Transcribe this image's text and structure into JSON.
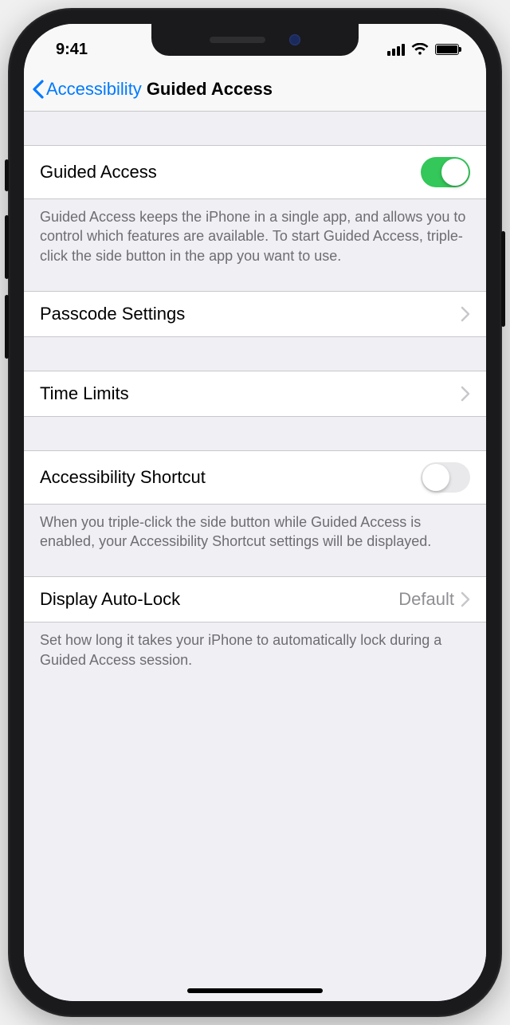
{
  "status": {
    "time": "9:41"
  },
  "nav": {
    "back_label": "Accessibility",
    "title": "Guided Access"
  },
  "rows": {
    "guided_access": {
      "label": "Guided Access",
      "enabled": true,
      "footer": "Guided Access keeps the iPhone in a single app, and allows you to control which features are available. To start Guided Access, triple-click the side button in the app you want to use."
    },
    "passcode": {
      "label": "Passcode Settings"
    },
    "time_limits": {
      "label": "Time Limits"
    },
    "accessibility_shortcut": {
      "label": "Accessibility Shortcut",
      "enabled": false,
      "footer": "When you triple-click the side button while Guided Access is enabled, your Accessibility Shortcut settings will be displayed."
    },
    "display_auto_lock": {
      "label": "Display Auto-Lock",
      "value": "Default",
      "footer": "Set how long it takes your iPhone to automatically lock during a Guided Access session."
    }
  }
}
